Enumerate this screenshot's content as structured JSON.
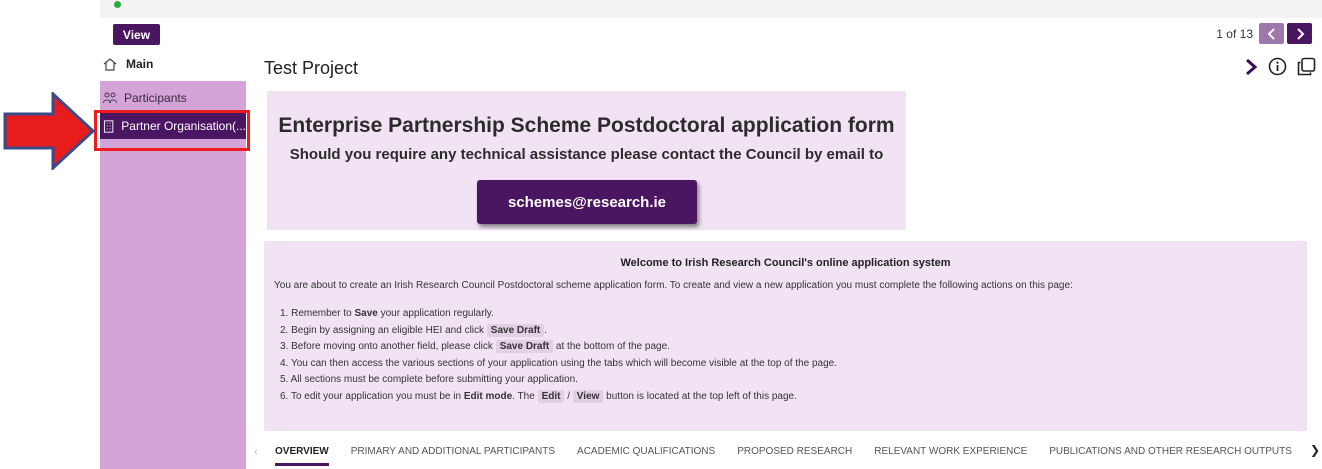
{
  "toolbar": {
    "view_label": "View",
    "pager_text": "1 of 13"
  },
  "sidebar": {
    "main_label": "Main",
    "items": [
      {
        "label": "Participants",
        "icon": "people-icon"
      },
      {
        "label": "Partner Organisation(...",
        "icon": "building-icon",
        "active": true
      }
    ]
  },
  "project": {
    "title": "Test Project"
  },
  "banner": {
    "heading": "Enterprise Partnership Scheme Postdoctoral application form",
    "subheading": "Should you require any technical assistance please contact the Council by email to",
    "email_button": "schemes@research.ie"
  },
  "welcome": {
    "title": "Welcome to Irish Research Council's online application system",
    "intro": "You are about to create an Irish Research Council Postdoctoral scheme application form. To create and view a new application you must complete the following actions on this page:",
    "steps": {
      "s1_pre": "1. Remember to ",
      "s1_bold": "Save",
      "s1_post": " your application regularly.",
      "s2_pre": "2. Begin by assigning an eligible HEI and click ",
      "s2_tag": "Save Draft",
      "s2_post": ".",
      "s3_pre": "3. Before moving onto another field, please click ",
      "s3_tag": "Save Draft",
      "s3_post": " at the bottom of the page.",
      "s4": "4. You can then access the various sections of your application using the tabs which will become visible at the top of the page.",
      "s5": "5. All sections must be complete before submitting your application.",
      "s6_pre": "6. To edit your application you must be in ",
      "s6_bold": "Edit mode",
      "s6_mid": ". The ",
      "s6_tag1": "Edit",
      "s6_sep": " / ",
      "s6_tag2": "View",
      "s6_post": " button is located at the top left of this page."
    }
  },
  "tabs": [
    "OVERVIEW",
    "PRIMARY AND ADDITIONAL PARTICIPANTS",
    "ACADEMIC QUALIFICATIONS",
    "PROPOSED RESEARCH",
    "RELEVANT WORK EXPERIENCE",
    "PUBLICATIONS AND OTHER RESEARCH OUTPUTS"
  ],
  "colors": {
    "brand": "#4a1561",
    "sidebar": "#d4a3d7",
    "panel": "#f1e3f3",
    "highlight": "#ee1c1c",
    "arrow": "#e81c1c",
    "arrow_outline": "#3b4a8a"
  }
}
